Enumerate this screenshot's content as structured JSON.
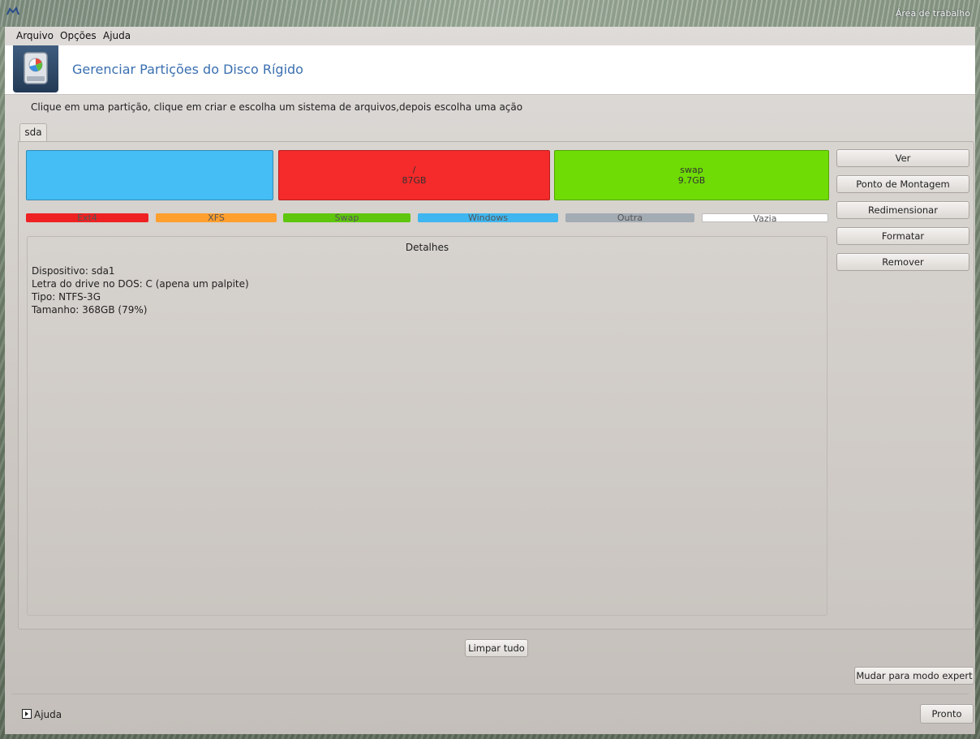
{
  "titlebar": {
    "text": "Área de trabalho"
  },
  "menu": {
    "items": [
      "Arquivo",
      "Opções",
      "Ajuda"
    ]
  },
  "banner": {
    "title": "Gerenciar Partições do Disco Rígido"
  },
  "instruction": "Clique em uma partição, clique em criar e escolha um sistema de arquivos,depois escolha uma ação",
  "tabs": [
    {
      "label": "sda"
    }
  ],
  "partitions": [
    {
      "mount": "",
      "size": "",
      "color": "#45bdf5"
    },
    {
      "mount": "/",
      "size": "87GB",
      "color": "#f52a2a"
    },
    {
      "mount": "swap",
      "size": "9.7GB",
      "color": "#6fdc05"
    }
  ],
  "legend": [
    {
      "label": "Ext4",
      "color": "#ee2222"
    },
    {
      "label": "XFS",
      "color": "#ff9f2e"
    },
    {
      "label": "Swap",
      "color": "#5ec60d"
    },
    {
      "label": "Windows",
      "color": "#3fb6ef"
    },
    {
      "label": "Outra",
      "color": "#a3abb3"
    },
    {
      "label": "Vazia",
      "color": "#ffffff"
    }
  ],
  "details": {
    "title": "Detalhes",
    "lines": [
      "Dispositivo: sda1",
      "Letra do drive no DOS: C (apena um palpite)",
      "Tipo: NTFS-3G",
      "Tamanho: 368GB (79%)"
    ]
  },
  "actions": [
    "Ver",
    "Ponto de Montagem",
    "Redimensionar",
    "Formatar",
    "Remover"
  ],
  "buttons": {
    "clear_all": "Limpar tudo",
    "expert_mode": "Mudar para modo expert",
    "done": "Pronto",
    "help": "Ajuda"
  }
}
